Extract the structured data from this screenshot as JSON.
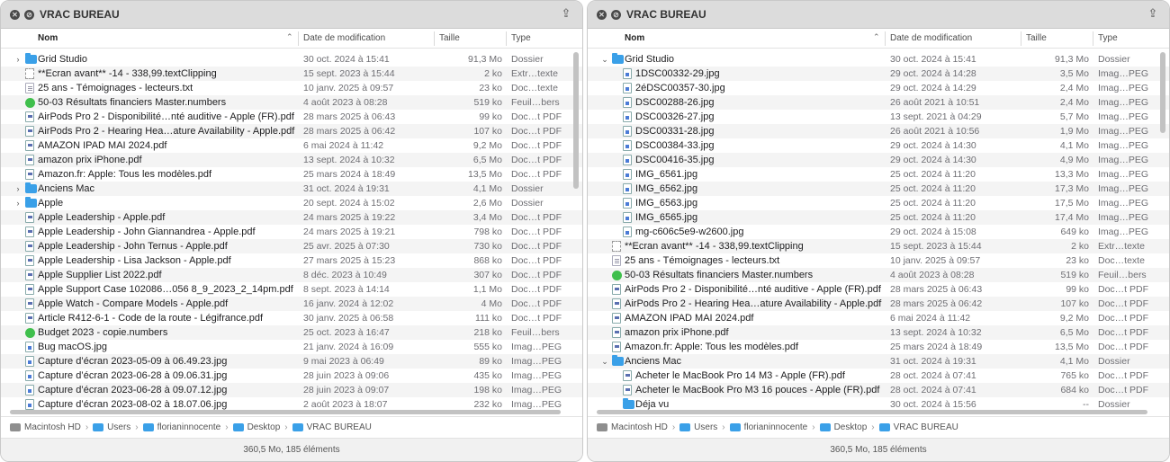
{
  "columns": {
    "name": "Nom",
    "date": "Date de modification",
    "size": "Taille",
    "type": "Type"
  },
  "left": {
    "title": "VRAC BUREAU",
    "path": [
      "Macintosh HD",
      "Users",
      "florianinnocente",
      "Desktop",
      "VRAC BUREAU"
    ],
    "status": "360,5 Mo, 185 éléments",
    "rows": [
      {
        "disc": "›",
        "icon": "folder",
        "name": "Grid Studio",
        "date": "30 oct. 2024 à 15:41",
        "size": "91,3 Mo",
        "type": "Dossier"
      },
      {
        "disc": "",
        "icon": "clip",
        "name": "**Ecran avant** -14 - 338,99.textClipping",
        "date": "15 sept. 2023 à 15:44",
        "size": "2 ko",
        "type": "Extr…texte"
      },
      {
        "disc": "",
        "icon": "doc",
        "name": "25 ans - Témoignages - lecteurs.txt",
        "date": "10 janv. 2025 à 09:57",
        "size": "23 ko",
        "type": "Doc…texte"
      },
      {
        "disc": "",
        "icon": "num",
        "name": "50-03 Résultats financiers Master.numbers",
        "date": "4 août 2023 à 08:28",
        "size": "519 ko",
        "type": "Feuil…bers"
      },
      {
        "disc": "",
        "icon": "pdf",
        "name": "AirPods Pro 2 - Disponibilité…nté auditive - Apple (FR).pdf",
        "date": "28 mars 2025 à 06:43",
        "size": "99 ko",
        "type": "Doc…t PDF"
      },
      {
        "disc": "",
        "icon": "pdf",
        "name": "AirPods Pro 2 - Hearing Hea…ature Availability - Apple.pdf",
        "date": "28 mars 2025 à 06:42",
        "size": "107 ko",
        "type": "Doc…t PDF"
      },
      {
        "disc": "",
        "icon": "pdf",
        "name": "AMAZON IPAD MAI 2024.pdf",
        "date": "6 mai 2024 à 11:42",
        "size": "9,2 Mo",
        "type": "Doc…t PDF"
      },
      {
        "disc": "",
        "icon": "pdf",
        "name": "amazon prix iPhone.pdf",
        "date": "13 sept. 2024 à 10:32",
        "size": "6,5 Mo",
        "type": "Doc…t PDF"
      },
      {
        "disc": "",
        "icon": "pdf",
        "name": "Amazon.fr: Apple: Tous les modèles.pdf",
        "date": "25 mars 2024 à 18:49",
        "size": "13,5 Mo",
        "type": "Doc…t PDF"
      },
      {
        "disc": "›",
        "icon": "folder",
        "name": "Anciens Mac",
        "date": "31 oct. 2024 à 19:31",
        "size": "4,1 Mo",
        "type": "Dossier"
      },
      {
        "disc": "›",
        "icon": "folder",
        "name": "Apple",
        "date": "20 sept. 2024 à 15:02",
        "size": "2,6 Mo",
        "type": "Dossier"
      },
      {
        "disc": "",
        "icon": "pdf",
        "name": "Apple Leadership - Apple.pdf",
        "date": "24 mars 2025 à 19:22",
        "size": "3,4 Mo",
        "type": "Doc…t PDF"
      },
      {
        "disc": "",
        "icon": "pdf",
        "name": "Apple Leadership - John Giannandrea - Apple.pdf",
        "date": "24 mars 2025 à 19:21",
        "size": "798 ko",
        "type": "Doc…t PDF"
      },
      {
        "disc": "",
        "icon": "pdf",
        "name": "Apple Leadership - John Ternus - Apple.pdf",
        "date": "25 avr. 2025 à 07:30",
        "size": "730 ko",
        "type": "Doc…t PDF"
      },
      {
        "disc": "",
        "icon": "pdf",
        "name": "Apple Leadership - Lisa Jackson - Apple.pdf",
        "date": "27 mars 2025 à 15:23",
        "size": "868 ko",
        "type": "Doc…t PDF"
      },
      {
        "disc": "",
        "icon": "pdf",
        "name": "Apple Supplier List 2022.pdf",
        "date": "8 déc. 2023 à 10:49",
        "size": "307 ko",
        "type": "Doc…t PDF"
      },
      {
        "disc": "",
        "icon": "pdf",
        "name": "Apple Support Case 102086…056 8_9_2023_2_14pm.pdf",
        "date": "8 sept. 2023 à 14:14",
        "size": "1,1 Mo",
        "type": "Doc…t PDF"
      },
      {
        "disc": "",
        "icon": "pdf",
        "name": "Apple Watch - Compare Models - Apple.pdf",
        "date": "16 janv. 2024 à 12:02",
        "size": "4 Mo",
        "type": "Doc…t PDF"
      },
      {
        "disc": "",
        "icon": "pdf",
        "name": "Article R412-6-1 - Code de la route - Légifrance.pdf",
        "date": "30 janv. 2025 à 06:58",
        "size": "111 ko",
        "type": "Doc…t PDF"
      },
      {
        "disc": "",
        "icon": "num",
        "name": "Budget 2023 - copie.numbers",
        "date": "25 oct. 2023 à 16:47",
        "size": "218 ko",
        "type": "Feuil…bers"
      },
      {
        "disc": "",
        "icon": "img",
        "name": "Bug macOS.jpg",
        "date": "21 janv. 2024 à 16:09",
        "size": "555 ko",
        "type": "Imag…PEG"
      },
      {
        "disc": "",
        "icon": "img",
        "name": "Capture d’écran 2023-05-09 à 06.49.23.jpg",
        "date": "9 mai 2023 à 06:49",
        "size": "89 ko",
        "type": "Imag…PEG"
      },
      {
        "disc": "",
        "icon": "img",
        "name": "Capture d’écran 2023-06-28 à 09.06.31.jpg",
        "date": "28 juin 2023 à 09:06",
        "size": "435 ko",
        "type": "Imag…PEG"
      },
      {
        "disc": "",
        "icon": "img",
        "name": "Capture d’écran 2023-06-28 à 09.07.12.jpg",
        "date": "28 juin 2023 à 09:07",
        "size": "198 ko",
        "type": "Imag…PEG"
      },
      {
        "disc": "",
        "icon": "img",
        "name": "Capture d’écran 2023-08-02 à 18.07.06.jpg",
        "date": "2 août 2023 à 18:07",
        "size": "232 ko",
        "type": "Imag…PEG"
      }
    ]
  },
  "right": {
    "title": "VRAC BUREAU",
    "path": [
      "Macintosh HD",
      "Users",
      "florianinnocente",
      "Desktop",
      "VRAC BUREAU"
    ],
    "status": "360,5 Mo, 185 éléments",
    "rows": [
      {
        "disc": "⌄",
        "icon": "folder",
        "indent": 0,
        "name": "Grid Studio",
        "date": "30 oct. 2024 à 15:41",
        "size": "91,3 Mo",
        "type": "Dossier"
      },
      {
        "disc": "",
        "icon": "img",
        "indent": 1,
        "name": "1DSC00332-29.jpg",
        "date": "29 oct. 2024 à 14:28",
        "size": "3,5 Mo",
        "type": "Imag…PEG"
      },
      {
        "disc": "",
        "icon": "img",
        "indent": 1,
        "name": "2éDSC00357-30.jpg",
        "date": "29 oct. 2024 à 14:29",
        "size": "2,4 Mo",
        "type": "Imag…PEG"
      },
      {
        "disc": "",
        "icon": "img",
        "indent": 1,
        "name": "DSC00288-26.jpg",
        "date": "26 août 2021 à 10:51",
        "size": "2,4 Mo",
        "type": "Imag…PEG"
      },
      {
        "disc": "",
        "icon": "img",
        "indent": 1,
        "name": "DSC00326-27.jpg",
        "date": "13 sept. 2021 à 04:29",
        "size": "5,7 Mo",
        "type": "Imag…PEG"
      },
      {
        "disc": "",
        "icon": "img",
        "indent": 1,
        "name": "DSC00331-28.jpg",
        "date": "26 août 2021 à 10:56",
        "size": "1,9 Mo",
        "type": "Imag…PEG"
      },
      {
        "disc": "",
        "icon": "img",
        "indent": 1,
        "name": "DSC00384-33.jpg",
        "date": "29 oct. 2024 à 14:30",
        "size": "4,1 Mo",
        "type": "Imag…PEG"
      },
      {
        "disc": "",
        "icon": "img",
        "indent": 1,
        "name": "DSC00416-35.jpg",
        "date": "29 oct. 2024 à 14:30",
        "size": "4,9 Mo",
        "type": "Imag…PEG"
      },
      {
        "disc": "",
        "icon": "img",
        "indent": 1,
        "name": "IMG_6561.jpg",
        "date": "25 oct. 2024 à 11:20",
        "size": "13,3 Mo",
        "type": "Imag…PEG"
      },
      {
        "disc": "",
        "icon": "img",
        "indent": 1,
        "name": "IMG_6562.jpg",
        "date": "25 oct. 2024 à 11:20",
        "size": "17,3 Mo",
        "type": "Imag…PEG"
      },
      {
        "disc": "",
        "icon": "img",
        "indent": 1,
        "name": "IMG_6563.jpg",
        "date": "25 oct. 2024 à 11:20",
        "size": "17,5 Mo",
        "type": "Imag…PEG"
      },
      {
        "disc": "",
        "icon": "img",
        "indent": 1,
        "name": "IMG_6565.jpg",
        "date": "25 oct. 2024 à 11:20",
        "size": "17,4 Mo",
        "type": "Imag…PEG"
      },
      {
        "disc": "",
        "icon": "img",
        "indent": 1,
        "name": "mg-c606c5e9-w2600.jpg",
        "date": "29 oct. 2024 à 15:08",
        "size": "649 ko",
        "type": "Imag…PEG"
      },
      {
        "disc": "",
        "icon": "clip",
        "indent": 0,
        "name": "**Ecran avant** -14 - 338,99.textClipping",
        "date": "15 sept. 2023 à 15:44",
        "size": "2 ko",
        "type": "Extr…texte"
      },
      {
        "disc": "",
        "icon": "doc",
        "indent": 0,
        "name": "25 ans - Témoignages - lecteurs.txt",
        "date": "10 janv. 2025 à 09:57",
        "size": "23 ko",
        "type": "Doc…texte"
      },
      {
        "disc": "",
        "icon": "num",
        "indent": 0,
        "name": "50-03 Résultats financiers Master.numbers",
        "date": "4 août 2023 à 08:28",
        "size": "519 ko",
        "type": "Feuil…bers"
      },
      {
        "disc": "",
        "icon": "pdf",
        "indent": 0,
        "name": "AirPods Pro 2 - Disponibilité…nté auditive - Apple (FR).pdf",
        "date": "28 mars 2025 à 06:43",
        "size": "99 ko",
        "type": "Doc…t PDF"
      },
      {
        "disc": "",
        "icon": "pdf",
        "indent": 0,
        "name": "AirPods Pro 2 - Hearing Hea…ature Availability - Apple.pdf",
        "date": "28 mars 2025 à 06:42",
        "size": "107 ko",
        "type": "Doc…t PDF"
      },
      {
        "disc": "",
        "icon": "pdf",
        "indent": 0,
        "name": "AMAZON IPAD MAI 2024.pdf",
        "date": "6 mai 2024 à 11:42",
        "size": "9,2 Mo",
        "type": "Doc…t PDF"
      },
      {
        "disc": "",
        "icon": "pdf",
        "indent": 0,
        "name": "amazon prix iPhone.pdf",
        "date": "13 sept. 2024 à 10:32",
        "size": "6,5 Mo",
        "type": "Doc…t PDF"
      },
      {
        "disc": "",
        "icon": "pdf",
        "indent": 0,
        "name": "Amazon.fr: Apple: Tous les modèles.pdf",
        "date": "25 mars 2024 à 18:49",
        "size": "13,5 Mo",
        "type": "Doc…t PDF"
      },
      {
        "disc": "⌄",
        "icon": "folder",
        "indent": 0,
        "name": "Anciens Mac",
        "date": "31 oct. 2024 à 19:31",
        "size": "4,1 Mo",
        "type": "Dossier"
      },
      {
        "disc": "",
        "icon": "pdf",
        "indent": 1,
        "name": "Acheter le MacBook Pro 14 M3 - Apple (FR).pdf",
        "date": "28 oct. 2024 à 07:41",
        "size": "765 ko",
        "type": "Doc…t PDF"
      },
      {
        "disc": "",
        "icon": "pdf",
        "indent": 1,
        "name": "Acheter le MacBook Pro M3 16 pouces - Apple (FR).pdf",
        "date": "28 oct. 2024 à 07:41",
        "size": "684 ko",
        "type": "Doc…t PDF"
      },
      {
        "disc": "",
        "icon": "folder",
        "indent": 1,
        "name": "Déja vu",
        "date": "30 oct. 2024 à 15:56",
        "size": "--",
        "type": "Dossier"
      }
    ]
  }
}
